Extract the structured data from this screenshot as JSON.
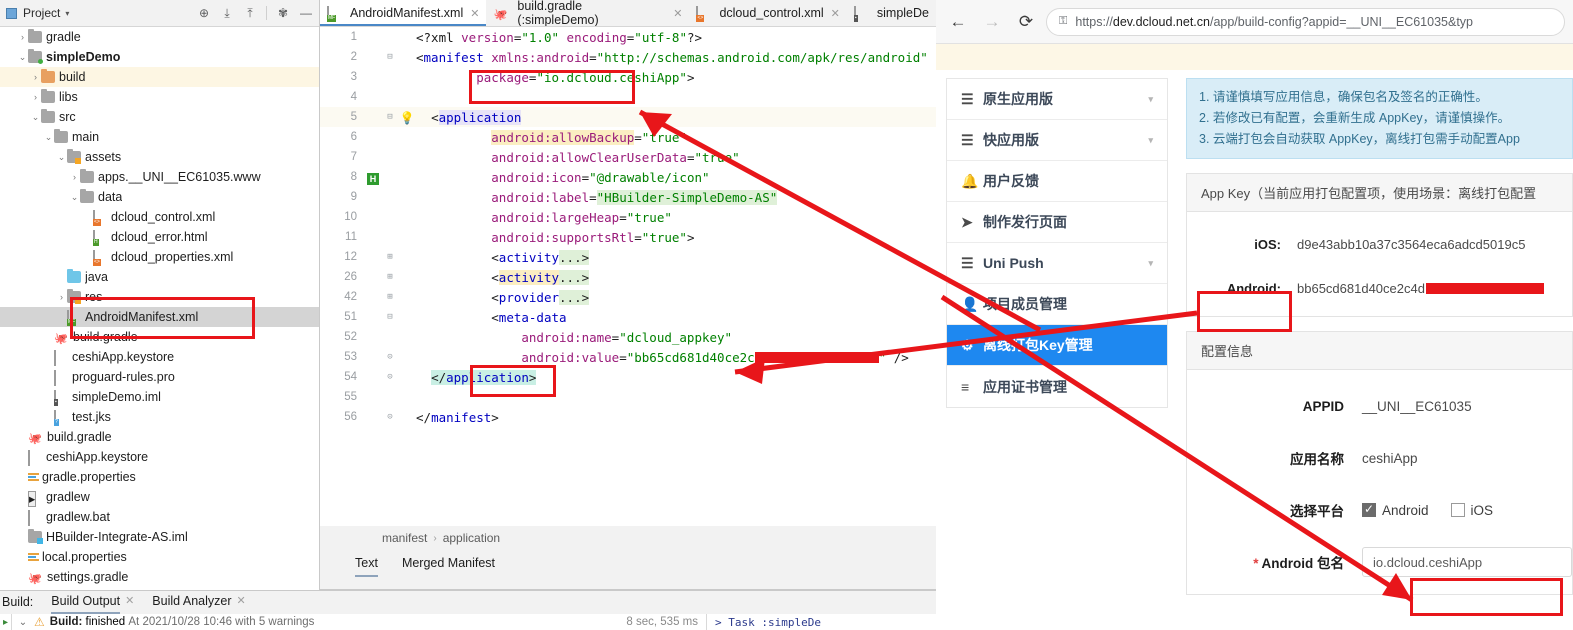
{
  "ide": {
    "project_panel": {
      "title": "Project",
      "caret": "▾",
      "tools": [
        "locate-icon",
        "expand-all-icon",
        "collapse-all-icon",
        "settings-gear-icon",
        "minimize-icon"
      ]
    },
    "tree": [
      {
        "indent": 1,
        "arrow": "›",
        "icon": "folder",
        "label": "gradle",
        "bold": false
      },
      {
        "indent": 1,
        "arrow": "⌄",
        "icon": "folder-green",
        "label": "simpleDemo",
        "bold": true
      },
      {
        "indent": 2,
        "arrow": "›",
        "icon": "folder-orange",
        "label": "build",
        "bold": false,
        "row": "hl-build"
      },
      {
        "indent": 2,
        "arrow": "›",
        "icon": "folder",
        "label": "libs",
        "bold": false
      },
      {
        "indent": 2,
        "arrow": "⌄",
        "icon": "folder",
        "label": "src",
        "bold": false
      },
      {
        "indent": 3,
        "arrow": "⌄",
        "icon": "folder",
        "label": "main",
        "bold": false
      },
      {
        "indent": 4,
        "arrow": "⌄",
        "icon": "folder-mark",
        "label": "assets",
        "bold": false
      },
      {
        "indent": 5,
        "arrow": "›",
        "icon": "folder",
        "label": "apps.__UNI__EC61035.www",
        "bold": false
      },
      {
        "indent": 5,
        "arrow": "⌄",
        "icon": "folder",
        "label": "data",
        "bold": false
      },
      {
        "indent": 6,
        "arrow": "",
        "icon": "file-xml",
        "label": "dcloud_control.xml",
        "bold": false
      },
      {
        "indent": 6,
        "arrow": "",
        "icon": "file-h",
        "label": "dcloud_error.html",
        "bold": false
      },
      {
        "indent": 6,
        "arrow": "",
        "icon": "file-xml",
        "label": "dcloud_properties.xml",
        "bold": false
      },
      {
        "indent": 4,
        "arrow": "",
        "icon": "folder-blue",
        "label": "java",
        "bold": false
      },
      {
        "indent": 4,
        "arrow": "›",
        "icon": "folder-mark",
        "label": "res",
        "bold": false
      },
      {
        "indent": 4,
        "arrow": "",
        "icon": "file-mf",
        "label": "AndroidManifest.xml",
        "bold": false,
        "row": "sel"
      },
      {
        "indent": 3,
        "arrow": "",
        "icon": "gradle",
        "label": "build.gradle",
        "bold": false
      },
      {
        "indent": 3,
        "arrow": "",
        "icon": "file-plain",
        "label": "ceshiApp.keystore",
        "bold": false
      },
      {
        "indent": 3,
        "arrow": "",
        "icon": "file-plain",
        "label": "proguard-rules.pro",
        "bold": false
      },
      {
        "indent": 3,
        "arrow": "",
        "icon": "file-iml",
        "label": "simpleDemo.iml",
        "bold": false
      },
      {
        "indent": 3,
        "arrow": "",
        "icon": "file-jks",
        "label": "test.jks",
        "bold": false
      },
      {
        "indent": 1,
        "arrow": "",
        "icon": "gradle",
        "label": "build.gradle",
        "bold": false
      },
      {
        "indent": 1,
        "arrow": "",
        "icon": "file-plain",
        "label": "ceshiApp.keystore",
        "bold": false
      },
      {
        "indent": 1,
        "arrow": "",
        "icon": "file-props",
        "label": "gradle.properties",
        "bold": false
      },
      {
        "indent": 1,
        "arrow": "",
        "icon": "file-script",
        "label": "gradlew",
        "bold": false
      },
      {
        "indent": 1,
        "arrow": "",
        "icon": "file-plain",
        "label": "gradlew.bat",
        "bold": false
      },
      {
        "indent": 1,
        "arrow": "",
        "icon": "folder-bluesq",
        "label": "HBuilder-Integrate-AS.iml",
        "bold": false
      },
      {
        "indent": 1,
        "arrow": "",
        "icon": "file-props",
        "label": "local.properties",
        "bold": false
      },
      {
        "indent": 1,
        "arrow": "",
        "icon": "gradle",
        "label": "settings.gradle",
        "bold": false
      }
    ],
    "editor_tabs": [
      {
        "icon": "file-mf",
        "label": "AndroidManifest.xml",
        "active": true,
        "close": "✕"
      },
      {
        "icon": "gradle",
        "label": "build.gradle (:simpleDemo)",
        "active": false,
        "close": "✕"
      },
      {
        "icon": "file-xml",
        "label": "dcloud_control.xml",
        "active": false,
        "close": "✕"
      },
      {
        "icon": "file-iml",
        "label": "simpleDe",
        "active": false,
        "close": ""
      }
    ],
    "code_lines": [
      {
        "num": "1",
        "fold": "",
        "gutter_badge": "",
        "bulb": false,
        "current": false,
        "html": "<span class=\"k-plain\">&lt;?xml </span><span class=\"k-attr\">version</span><span class=\"k-plain\">=</span><span class=\"k-val\">\"1.0\"</span><span class=\"k-plain\"> </span><span class=\"k-attr\">encoding</span><span class=\"k-plain\">=</span><span class=\"k-val\">\"utf-8\"</span><span class=\"k-plain\">?&gt;</span>",
        "indent": 0
      },
      {
        "num": "2",
        "fold": "⊟",
        "gutter_badge": "",
        "bulb": false,
        "current": false,
        "html": "<span class=\"k-plain\">&lt;</span><span class=\"k-tag\">manifest</span><span class=\"k-plain\"> </span><span class=\"k-attr\">xmlns:android</span><span class=\"k-plain\">=</span><span class=\"k-val\">\"http://schemas.android.com/apk/res/android\"</span>",
        "indent": 0
      },
      {
        "num": "3",
        "fold": "",
        "gutter_badge": "",
        "bulb": false,
        "current": false,
        "html": "<span class=\"k-attr\">package</span><span class=\"k-plain\">=</span><span class=\"k-val\">\"io.dcloud.ceshiApp\"</span><span class=\"k-plain\">&gt;</span>",
        "indent": 4
      },
      {
        "num": "4",
        "fold": "",
        "gutter_badge": "",
        "bulb": false,
        "current": false,
        "html": "",
        "indent": 0
      },
      {
        "num": "5",
        "fold": "⊟",
        "gutter_badge": "",
        "bulb": true,
        "current": true,
        "html": "<span class=\"k-plain\">&lt;</span><span class=\"hl-purple k-tag\">application</span>",
        "indent": 1
      },
      {
        "num": "6",
        "fold": "",
        "gutter_badge": "",
        "bulb": false,
        "current": false,
        "html": "<span class=\"hl-yellow\"><span class=\"k-attr\">android:allowBackup</span></span><span class=\"k-plain\">=</span><span class=\"k-val\">\"true\"</span>",
        "indent": 5
      },
      {
        "num": "7",
        "fold": "",
        "gutter_badge": "",
        "bulb": false,
        "current": false,
        "html": "<span class=\"k-attr\">android:allowClearUserData</span><span class=\"k-plain\">=</span><span class=\"k-val\">\"true\"</span>",
        "indent": 5
      },
      {
        "num": "8",
        "fold": "",
        "gutter_badge": "H",
        "bulb": false,
        "current": false,
        "html": "<span class=\"k-attr\">android:icon</span><span class=\"k-plain\">=</span><span class=\"k-val\">\"@drawable/icon\"</span>",
        "indent": 5
      },
      {
        "num": "9",
        "fold": "",
        "gutter_badge": "",
        "bulb": false,
        "current": false,
        "html": "<span class=\"k-attr\">android:label</span><span class=\"k-plain\">=</span><span class=\"hl-green k-val\">\"HBuilder-SimpleDemo-AS\"</span>",
        "indent": 5
      },
      {
        "num": "10",
        "fold": "",
        "gutter_badge": "",
        "bulb": false,
        "current": false,
        "html": "<span class=\"k-attr\">android:largeHeap</span><span class=\"k-plain\">=</span><span class=\"k-val\">\"true\"</span>",
        "indent": 5
      },
      {
        "num": "11",
        "fold": "",
        "gutter_badge": "",
        "bulb": false,
        "current": false,
        "html": "<span class=\"k-attr\">android:supportsRtl</span><span class=\"k-plain\">=</span><span class=\"k-val\">\"true\"</span><span class=\"k-plain\">&gt;</span>",
        "indent": 5
      },
      {
        "num": "12",
        "fold": "⊞",
        "gutter_badge": "",
        "bulb": false,
        "current": false,
        "html": "<span class=\"k-plain\">&lt;</span><span class=\"k-tag\">activity</span><span class=\"hl-green k-plain\">...&gt;</span>",
        "indent": 5
      },
      {
        "num": "26",
        "fold": "⊞",
        "gutter_badge": "",
        "bulb": false,
        "current": false,
        "html": "<span class=\"k-plain\">&lt;</span><span class=\"hl-yellow k-tag\">activity</span><span class=\"hl-green k-plain\">...&gt;</span>",
        "indent": 5
      },
      {
        "num": "42",
        "fold": "⊞",
        "gutter_badge": "",
        "bulb": false,
        "current": false,
        "html": "<span class=\"k-plain\">&lt;</span><span class=\"k-tag\">provider</span><span class=\"hl-green k-plain\">...&gt;</span>",
        "indent": 5
      },
      {
        "num": "51",
        "fold": "⊟",
        "gutter_badge": "",
        "bulb": false,
        "current": false,
        "html": "<span class=\"k-plain\">&lt;</span><span class=\"k-tag\">meta-data</span>",
        "indent": 5
      },
      {
        "num": "52",
        "fold": "",
        "gutter_badge": "",
        "bulb": false,
        "current": false,
        "html": "<span class=\"k-attr\">android:name</span><span class=\"k-plain\">=</span><span class=\"k-val\">\"dcloud_appkey\"</span>",
        "indent": 7
      },
      {
        "num": "53",
        "fold": "⊝",
        "gutter_badge": "",
        "bulb": false,
        "current": false,
        "html": "<span class=\"k-attr\">android:value</span><span class=\"k-plain\">=</span><span class=\"k-val\">\"bb65cd681d40ce2c</span><span class=\"redact\" style=\"width:124px\"></span><span class=\"k-val\">\"</span><span class=\"k-plain\"> /&gt;</span>",
        "indent": 7
      },
      {
        "num": "54",
        "fold": "⊝",
        "gutter_badge": "",
        "bulb": false,
        "current": false,
        "html": "<span class=\"hl-teal\"><span class=\"k-plain\">&lt;/</span><span class=\"k-tag\">application</span><span class=\"k-plain\">&gt;</span></span>",
        "indent": 1
      },
      {
        "num": "55",
        "fold": "",
        "gutter_badge": "",
        "bulb": false,
        "current": false,
        "html": "",
        "indent": 0
      },
      {
        "num": "56",
        "fold": "⊝",
        "gutter_badge": "",
        "bulb": false,
        "current": false,
        "html": "<span class=\"k-plain\">&lt;/</span><span class=\"k-tag\">manifest</span><span class=\"k-plain\">&gt;</span>",
        "indent": 0
      }
    ],
    "breadcrumb": {
      "first": "manifest",
      "sep": "›",
      "second": "application"
    },
    "editor_bottom_tabs": [
      {
        "label": "Text",
        "active": true
      },
      {
        "label": "Merged Manifest",
        "active": false
      }
    ],
    "build_panel": {
      "title": "Build:",
      "tabs": [
        {
          "label": "Build Output",
          "active": true,
          "close": "✕"
        },
        {
          "label": "Build Analyzer",
          "active": false,
          "close": "✕"
        }
      ],
      "output": {
        "chevron": "⌄",
        "warn_icon": "warning-triangle-icon",
        "bold": "Build:",
        "status": "finished",
        "detail": "At 2021/10/28 10:46 with 5 warnings",
        "duration": "8 sec, 535 ms",
        "right_text": "> Task :simpleDe"
      }
    }
  },
  "browser": {
    "nav": {
      "back": "←",
      "forward": "→",
      "reload": "⟳"
    },
    "url": {
      "lock": "🔒",
      "scheme": "https://",
      "host": "dev.dcloud.net.cn",
      "path": "/app/build-config?appid=__UNI__EC61035&typ"
    },
    "menu": [
      {
        "icon": "list-icon",
        "label": "原生应用版",
        "caret": "▾",
        "active": false
      },
      {
        "icon": "list-icon",
        "label": "快应用版",
        "caret": "▾",
        "active": false
      },
      {
        "icon": "bell-icon",
        "label": "用户反馈",
        "caret": "",
        "active": false
      },
      {
        "icon": "send-icon",
        "label": "制作发行页面",
        "caret": "",
        "active": false
      },
      {
        "icon": "list-icon",
        "label": "Uni Push",
        "caret": "▾",
        "active": false
      },
      {
        "icon": "user-icon",
        "label": "项目成员管理",
        "caret": "",
        "active": false
      },
      {
        "icon": "gear-icon",
        "label": "离线打包Key管理",
        "caret": "",
        "active": true
      },
      {
        "icon": "listalt-icon",
        "label": "应用证书管理",
        "caret": "",
        "active": false
      }
    ],
    "notice": [
      "1. 请谨慎填写应用信息，确保包名及签名的正确性。",
      "2. 若修改已有配置，会重新生成 AppKey，请谨慎操作。",
      "3. 云端打包会自动获取 AppKey，离线打包需手动配置App"
    ],
    "appkey_card": {
      "header": "App Key（当前应用打包配置项，使用场景：离线打包配置",
      "rows": [
        {
          "label": "iOS:",
          "value": "d9e43abb10a37c3564eca6adcd5019c5",
          "redacted": false
        },
        {
          "label": "Android:",
          "value": "bb65cd681d40ce2c4d",
          "redacted": true
        }
      ]
    },
    "config_card": {
      "header": "配置信息",
      "rows": [
        {
          "type": "text",
          "label": "APPID",
          "value": "__UNI__EC61035",
          "required": false
        },
        {
          "type": "text",
          "label": "应用名称",
          "value": "ceshiApp",
          "required": false
        },
        {
          "type": "checks",
          "label": "选择平台",
          "required": false,
          "options": [
            {
              "label": "Android",
              "checked": true
            },
            {
              "label": "iOS",
              "checked": false
            }
          ]
        },
        {
          "type": "input",
          "label": "Android 包名",
          "value": "io.dcloud.ceshiApp",
          "required": true,
          "star": "*"
        }
      ]
    }
  },
  "annotations": {
    "color": "#e8161a",
    "boxes": [
      {
        "name": "package-name-box"
      },
      {
        "name": "manifest-file-box"
      },
      {
        "name": "appkey-value-box"
      },
      {
        "name": "android-key-label-box"
      },
      {
        "name": "android-package-input-box"
      }
    ]
  }
}
